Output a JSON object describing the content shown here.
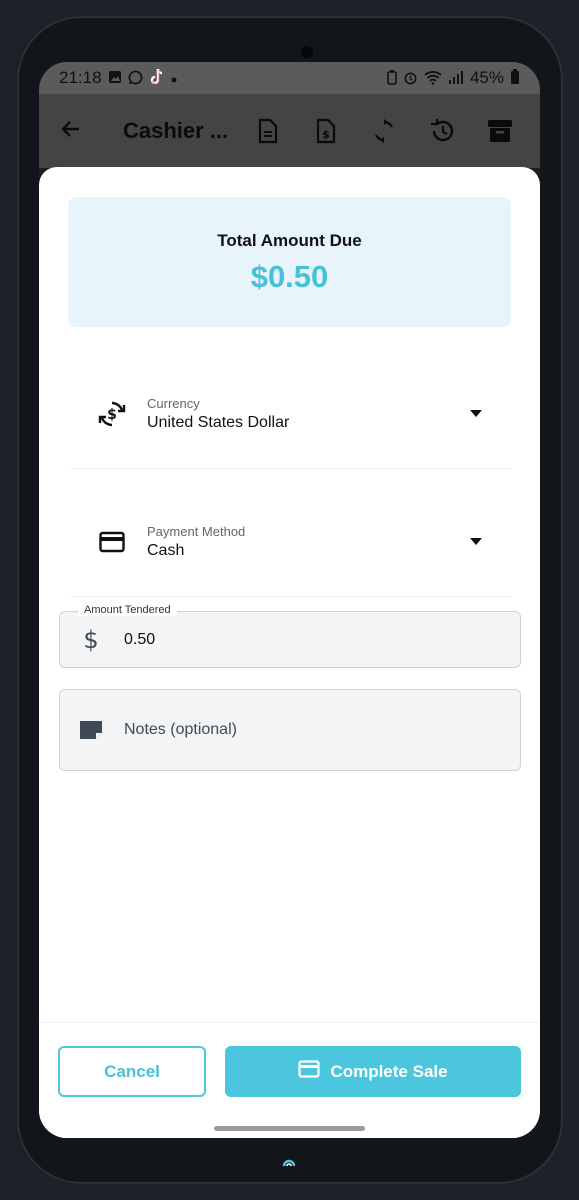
{
  "status": {
    "time": "21:18",
    "battery": "45%",
    "left_icons": [
      "gallery-icon",
      "whatsapp-icon",
      "tiktok-icon",
      "dot-icon"
    ],
    "right_icons": [
      "battery-saver-icon",
      "alarm-icon",
      "wifi-icon",
      "signal-icon",
      "battery-icon"
    ]
  },
  "appbar": {
    "title": "Cashier ...",
    "icons": [
      "back-arrow-icon",
      "document-icon",
      "invoice-icon",
      "sync-icon",
      "history-icon",
      "archive-icon"
    ]
  },
  "due": {
    "label": "Total Amount Due",
    "amount": "$0.50"
  },
  "currency": {
    "caption": "Currency",
    "value": "United States Dollar"
  },
  "payment": {
    "caption": "Payment Method",
    "value": "Cash"
  },
  "tender": {
    "legend": "Amount Tendered",
    "value": "0.50"
  },
  "notes": {
    "placeholder": "Notes (optional)"
  },
  "footer": {
    "cancel_label": "Cancel",
    "complete_label": "Complete Sale"
  },
  "colors": {
    "accent": "#45c2d9",
    "due_background": "#e7f5fa"
  }
}
